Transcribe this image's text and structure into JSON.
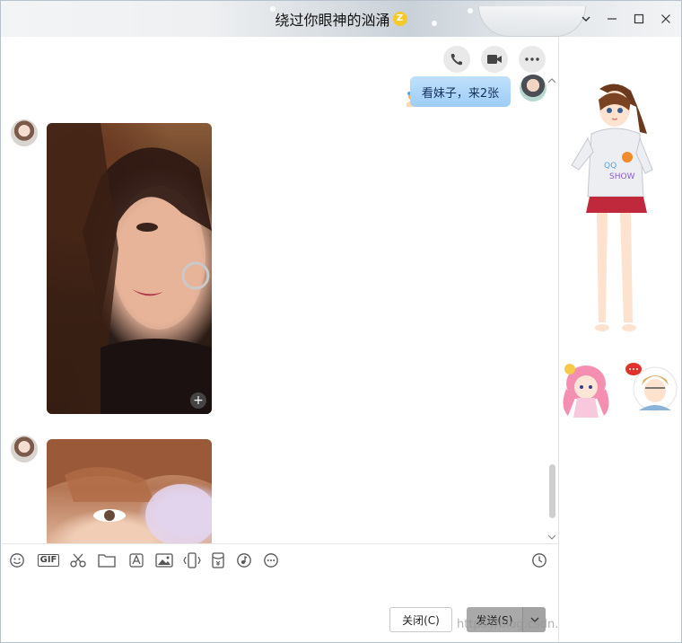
{
  "window": {
    "title": "绕过你眼神的汹涌",
    "title_badge_icon": "vip-badge-icon",
    "title_badge_text": "Z",
    "controls": [
      "chevron-down-icon",
      "minimize-icon",
      "maximize-icon",
      "close-icon"
    ]
  },
  "header_actions": [
    {
      "name": "voice-call-button",
      "icon": "phone-icon"
    },
    {
      "name": "video-call-button",
      "icon": "video-camera-icon"
    },
    {
      "name": "more-button",
      "icon": "more-dots-icon"
    }
  ],
  "messages": [
    {
      "sender": "me",
      "type": "text",
      "text": "看妹子，来2张"
    },
    {
      "sender": "friend",
      "type": "image",
      "description_icon": "portrait-photo"
    },
    {
      "sender": "friend",
      "type": "image",
      "description_icon": "portrait-photo"
    }
  ],
  "toolbar": {
    "gif_label": "GIF",
    "tools": [
      "emoji-icon",
      "gif-icon",
      "scissors-icon",
      "folder-icon",
      "font-icon",
      "image-icon",
      "shake-icon",
      "red-packet-icon",
      "music-icon",
      "more-icon",
      "history-clock-icon"
    ]
  },
  "footer": {
    "close_label": "关闭(C)",
    "send_label": "发送(S)",
    "watermark": "https://blog.csdn.net/qq_33591903"
  },
  "right_panel": {
    "figures": [
      "qq-show-avatar-girl",
      "qq-show-small-girl",
      "qq-show-boy-avatar"
    ]
  },
  "colors": {
    "bubble": "#a6d0f7",
    "send_button": "#a9a9a9",
    "title_bar": "#e6eaee"
  }
}
